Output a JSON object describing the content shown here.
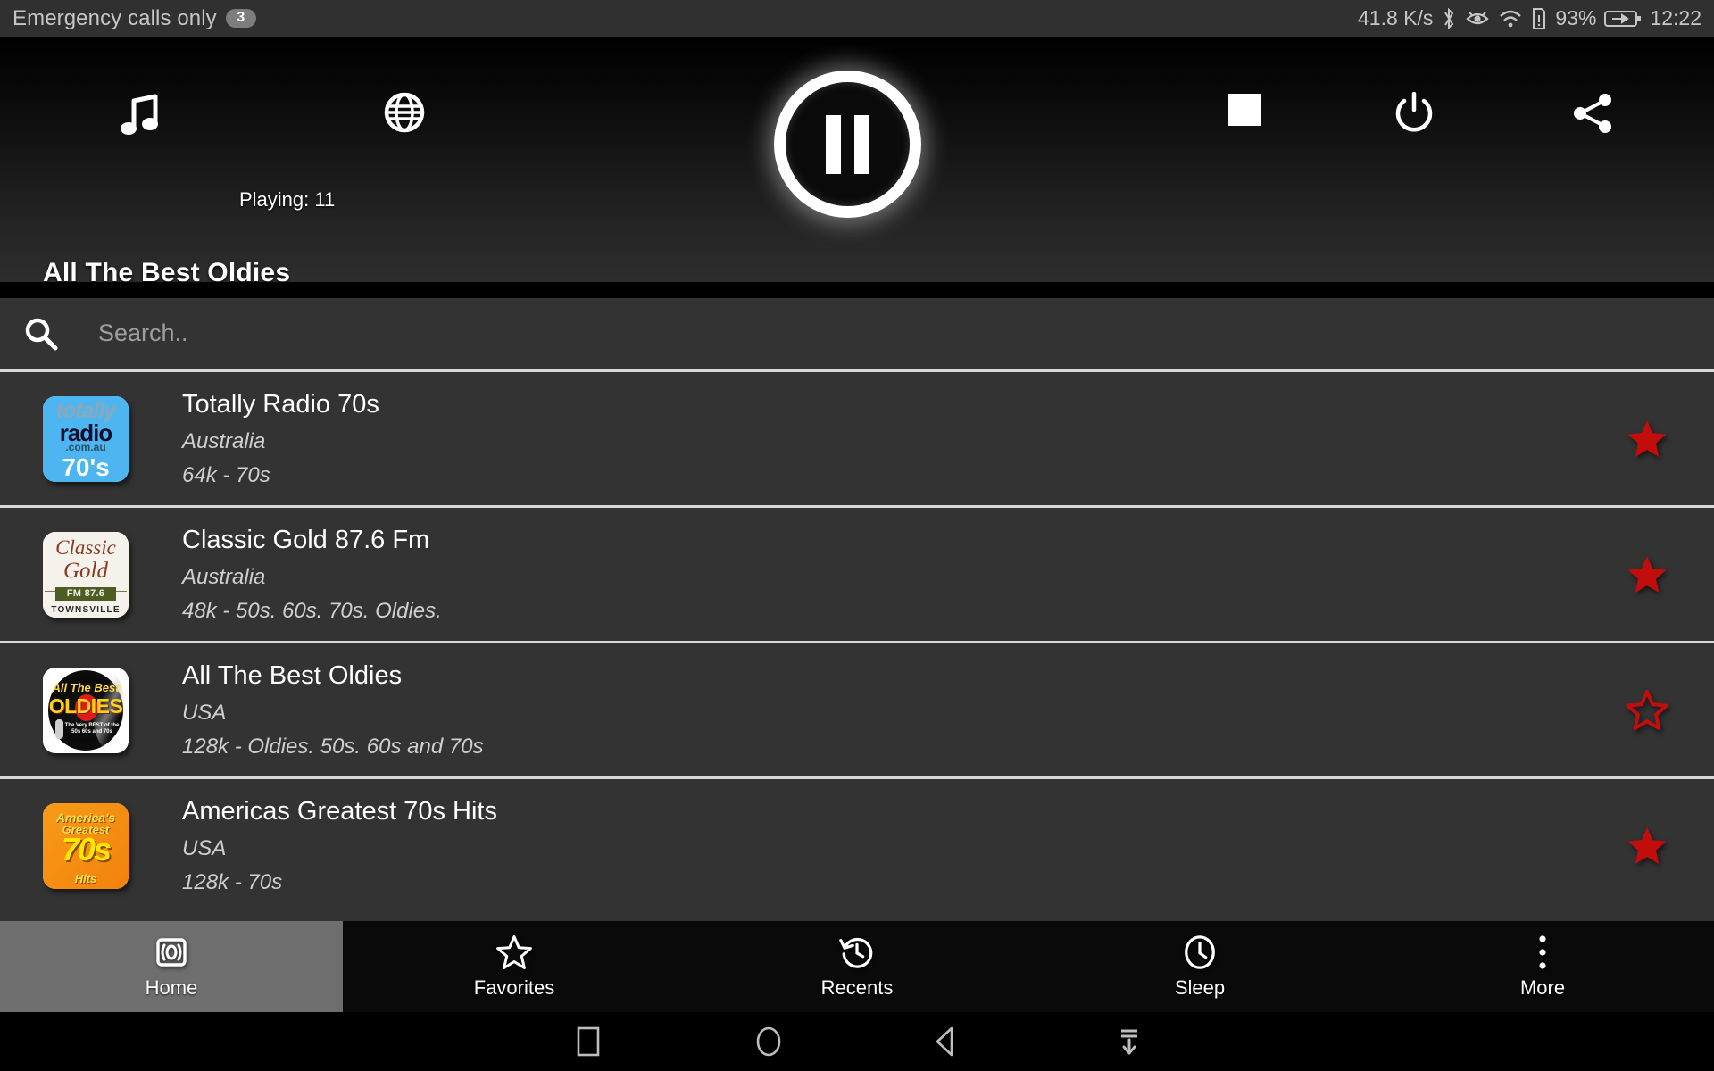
{
  "statusbar": {
    "carrier": "Emergency calls only",
    "notification_count": "3",
    "network_speed": "41.8 K/s",
    "battery_percent": "93%",
    "clock": "12:22",
    "icons": [
      "bluetooth-icon",
      "eye-icon",
      "wifi-icon",
      "sim-alert-icon",
      "battery-charging-icon"
    ]
  },
  "player": {
    "music_icon": "music-note-icon",
    "globe_icon": "globe-icon",
    "playing_label": "Playing: 11",
    "playpause_icon": "pause-icon",
    "stop_icon": "stop-square-icon",
    "power_icon": "power-icon",
    "share_icon": "share-icon",
    "station_title": "All The Best Oldies"
  },
  "search": {
    "icon": "search-icon",
    "placeholder": "Search..",
    "value": ""
  },
  "stations": [
    {
      "name": "Totally Radio 70s",
      "country": "Australia",
      "desc": "64k - 70s",
      "favorite": true,
      "logo": {
        "kind": "totally",
        "l1": "totally",
        "l2": "radio",
        "l3": ".com.au",
        "l4": "70's"
      }
    },
    {
      "name": "Classic Gold 87.6 Fm",
      "country": "Australia",
      "desc": "48k - 50s. 60s. 70s. Oldies.",
      "favorite": true,
      "logo": {
        "kind": "classic",
        "l1": "Classic",
        "l2": "Gold",
        "l3": "FM 87.6",
        "l4": "TOWNSVILLE"
      }
    },
    {
      "name": "All The Best Oldies",
      "country": "USA",
      "desc": "128k - Oldies. 50s. 60s and 70s",
      "favorite": false,
      "logo": {
        "kind": "oldies",
        "l1": "All The Best",
        "l2": "OLDIES",
        "l3": "The Very BEST of the 50s 60s and 70s"
      }
    },
    {
      "name": "Americas Greatest 70s Hits",
      "country": "USA",
      "desc": "128k - 70s",
      "favorite": true,
      "logo": {
        "kind": "americas",
        "l1": "America's",
        "l2": "Greatest",
        "l3": "70s",
        "l4": "Hits"
      }
    }
  ],
  "tabs": [
    {
      "label": "Home",
      "icon": "broadcast-icon",
      "active": true
    },
    {
      "label": "Favorites",
      "icon": "star-outline-icon",
      "active": false
    },
    {
      "label": "Recents",
      "icon": "history-icon",
      "active": false
    },
    {
      "label": "Sleep",
      "icon": "clock-icon",
      "active": false
    },
    {
      "label": "More",
      "icon": "overflow-dots-icon",
      "active": false
    }
  ],
  "sysnav": {
    "recents_icon": "square-icon",
    "home_icon": "circle-icon",
    "back_icon": "triangle-back-icon",
    "hide_icon": "hide-navbar-icon"
  },
  "colors": {
    "favorite_star": "#c20d0d",
    "list_bg": "#333333",
    "divider": "#d8d8d8",
    "active_tab": "#6e6e6e"
  }
}
